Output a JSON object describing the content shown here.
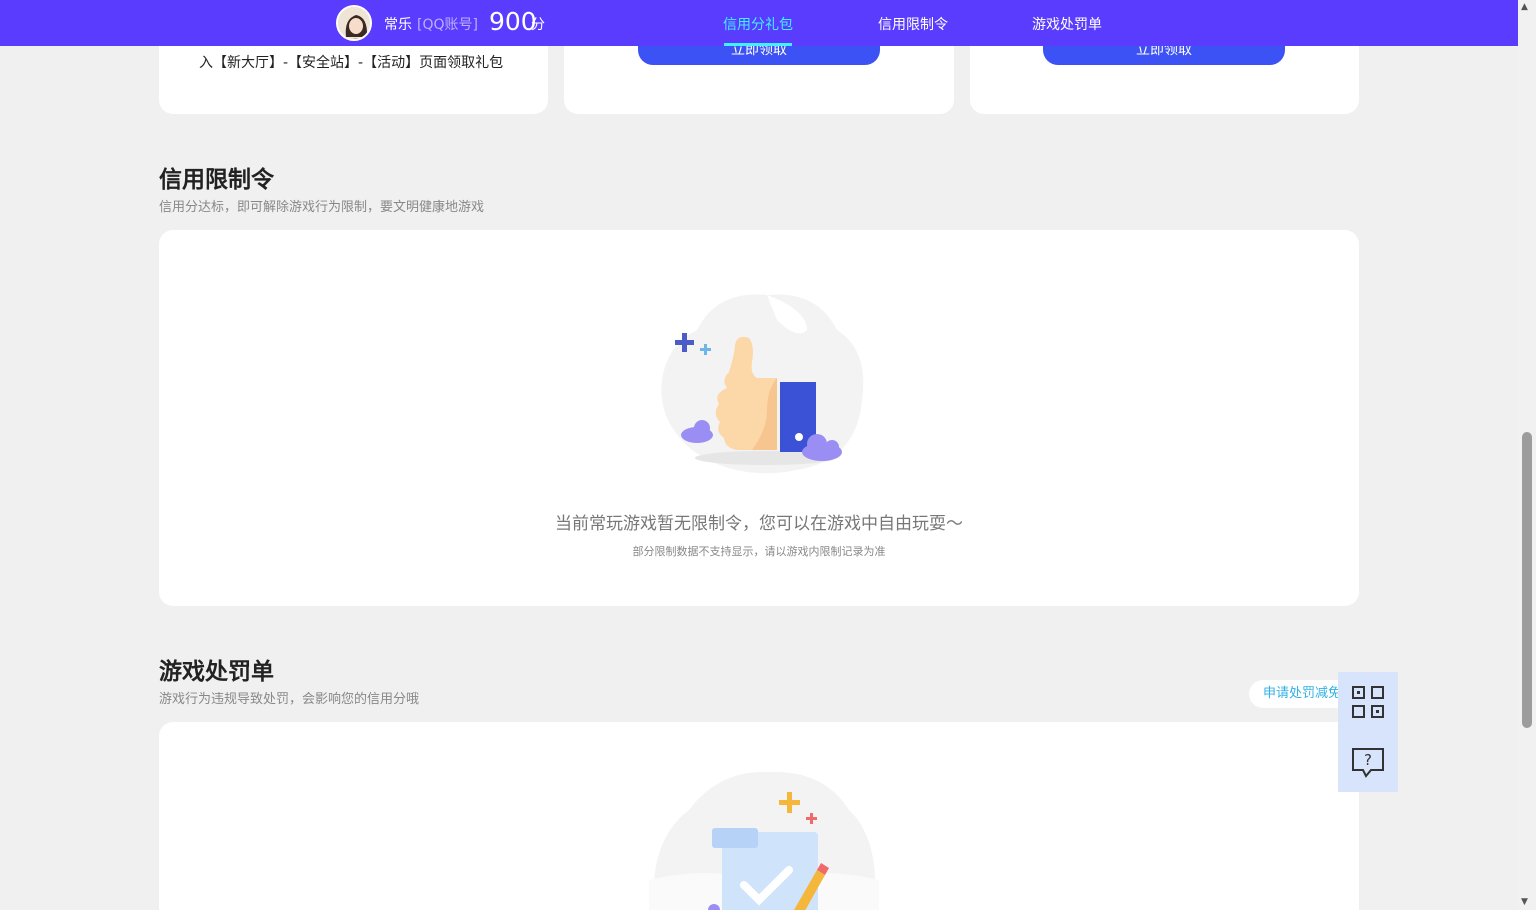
{
  "header": {
    "nickname": "常乐",
    "account_type": "[QQ账号]",
    "score": "900",
    "score_unit": "分",
    "tabs": [
      {
        "label": "信用分礼包",
        "active": true
      },
      {
        "label": "信用限制令",
        "active": false
      },
      {
        "label": "游戏处罚单",
        "active": false
      }
    ]
  },
  "gift_cards": {
    "card1_text": "入【新大厅】-【安全站】-【活动】页面领取礼包",
    "card2_button": "立即领取",
    "card3_button": "立即领取"
  },
  "restriction": {
    "title": "信用限制令",
    "subtitle": "信用分达标，即可解除游戏行为限制，要文明健康地游戏",
    "empty_main": "当前常玩游戏暂无限制令，您可以在游戏中自由玩耍～",
    "empty_sub": "部分限制数据不支持显示，请以游戏内限制记录为准"
  },
  "penalty": {
    "title": "游戏处罚单",
    "subtitle": "游戏行为违规导致处罚，会影响您的信用分哦",
    "appeal_label": "申请处罚减免"
  },
  "side": {
    "qr_icon": "qr-code-icon",
    "help_icon": "help-chat-icon"
  },
  "colors": {
    "nav_bg": "#5a3cff",
    "active_tab": "#3ff2ff",
    "button": "#3d52f4",
    "page_bg": "#f0f0f0",
    "appeal_text": "#2fb1e6"
  }
}
